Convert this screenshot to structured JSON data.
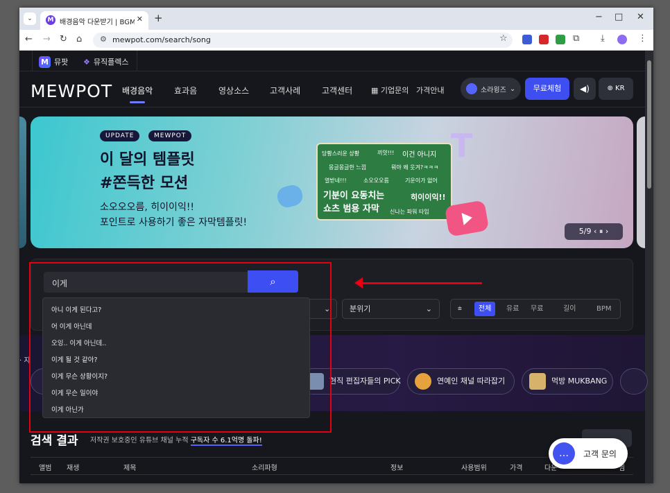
{
  "browser": {
    "tab_title": "배경음악 다운받기 | BGM 사이",
    "url": "mewpot.com/search/song",
    "new_tab": "+",
    "minimize": "−",
    "maximize": "□",
    "close": "✕"
  },
  "subnav": {
    "mewpot": "뮤팟",
    "musicplus": "뮤직플렉스"
  },
  "gnb": {
    "logo": "MEWPOT",
    "menu": [
      "배경음악",
      "효과음",
      "영상소스",
      "고객사례",
      "고객센터",
      "기업문의",
      "가격안내"
    ],
    "account": "소라윙즈",
    "trial": "무료체험",
    "lang": "KR"
  },
  "banner": {
    "tags": [
      "UPDATE",
      "MEWPOT"
    ],
    "title1": "이 달의 템플릿",
    "title2": "#쫀득한 모션",
    "sub1": "소오오오름, 히이이익!!",
    "sub2": "포인트로 사용하기 좋은 자막템플릿!",
    "card": [
      "당황스러운 상황",
      "끼얏!!!",
      "이건 아니지",
      "몽글몽글한 느낌",
      "뭐야 왜 웃겨?ㅋㅋㅋ",
      "열받네!!!",
      "소오오오름",
      "기운이가 없어",
      "기분이 요동치는",
      "히이이익!!",
      "쇼츠 범용 자막",
      "신나는 파워 타임"
    ],
    "pager": "5/9  ‹  ⏸  ›",
    "accent_color": "#3cc7cf"
  },
  "search": {
    "query": "이게",
    "suggestions": [
      "아니 이게 된다고?",
      "어 이게 아닌데",
      "오잉.. 이게 아닌데..",
      "이게 될 것 같아?",
      "이게 무슨 상황이지?",
      "이게 무슨 일이야",
      "이게 아닌가"
    ]
  },
  "filters": {
    "mood": "분위기",
    "segments": [
      "전체",
      "유료",
      "무료",
      "길이",
      "BPM"
    ]
  },
  "categories": {
    "label": "· 지",
    "chips": [
      "현직 편집자들의 PICK",
      "연예인 채널 따라잡기",
      "먹방 MUKBANG"
    ]
  },
  "results": {
    "title": "검색 결과",
    "sub_prefix": "저작권 보호중인 유튜브 채널 누적 ",
    "sub_highlight": "구독자 수 6.1억명 돌파!",
    "columns": [
      "앨범",
      "재생",
      "제목",
      "소리파형",
      "정보",
      "사용범위",
      "가격",
      "다운",
      "찜"
    ]
  },
  "help": {
    "label": "고객 문의"
  }
}
